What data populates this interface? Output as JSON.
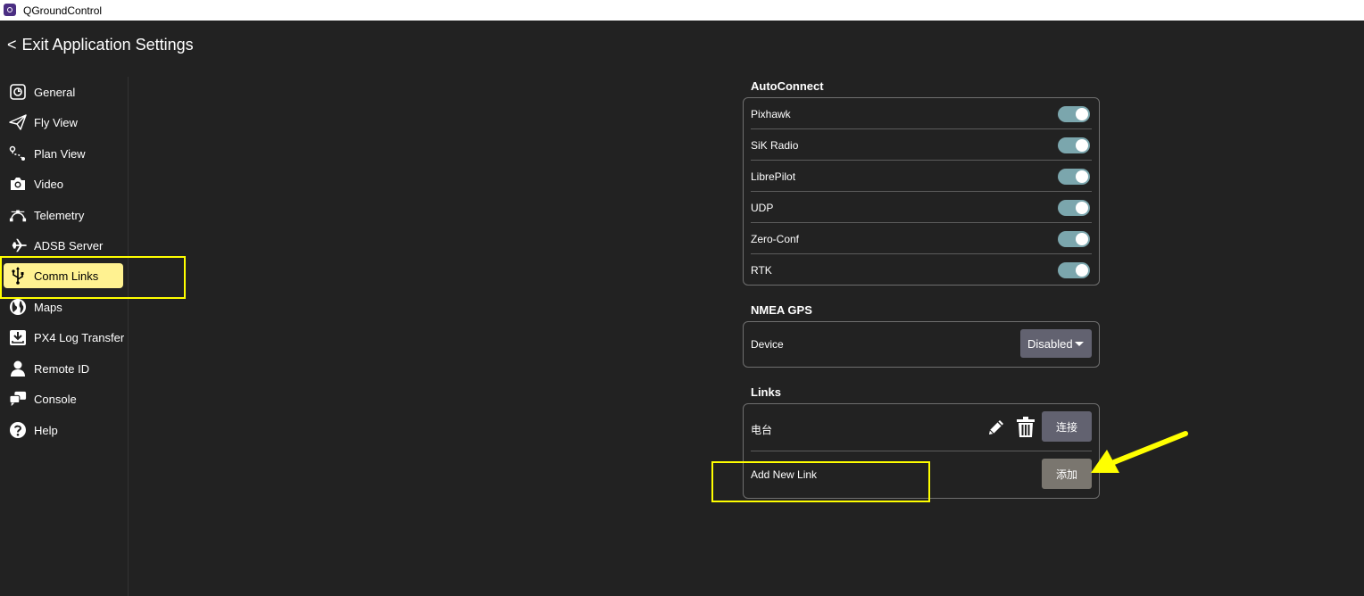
{
  "window": {
    "title": "QGroundControl"
  },
  "header": {
    "back_chevron": "<",
    "back_label": "Exit Application Settings"
  },
  "sidebar": {
    "items": [
      {
        "label": "General",
        "icon": "general-icon"
      },
      {
        "label": "Fly View",
        "icon": "paper-plane-icon"
      },
      {
        "label": "Plan View",
        "icon": "route-icon"
      },
      {
        "label": "Video",
        "icon": "camera-icon"
      },
      {
        "label": "Telemetry",
        "icon": "telemetry-icon"
      },
      {
        "label": "ADSB Server",
        "icon": "airplane-icon"
      },
      {
        "label": "Comm Links",
        "icon": "usb-icon",
        "active": true
      },
      {
        "label": "Maps",
        "icon": "globe-icon"
      },
      {
        "label": "PX4 Log Transfer",
        "icon": "download-icon"
      },
      {
        "label": "Remote ID",
        "icon": "person-icon"
      },
      {
        "label": "Console",
        "icon": "chat-icon"
      },
      {
        "label": "Help",
        "icon": "help-icon"
      }
    ]
  },
  "autoconnect": {
    "title": "AutoConnect",
    "items": [
      {
        "label": "Pixhawk",
        "enabled": true
      },
      {
        "label": "SiK Radio",
        "enabled": true
      },
      {
        "label": "LibrePilot",
        "enabled": true
      },
      {
        "label": "UDP",
        "enabled": true
      },
      {
        "label": "Zero-Conf",
        "enabled": true
      },
      {
        "label": "RTK",
        "enabled": true
      }
    ]
  },
  "nmea": {
    "title": "NMEA GPS",
    "device_label": "Device",
    "device_value": "Disabled"
  },
  "links": {
    "title": "Links",
    "items": [
      {
        "name": "电台",
        "connect_label": "连接"
      }
    ],
    "add_label": "Add New Link",
    "add_button": "添加"
  },
  "colors": {
    "background": "#222222",
    "accent_highlight": "#fff291",
    "toggle_on": "#7ba6ad",
    "annotation": "#ffff00"
  }
}
